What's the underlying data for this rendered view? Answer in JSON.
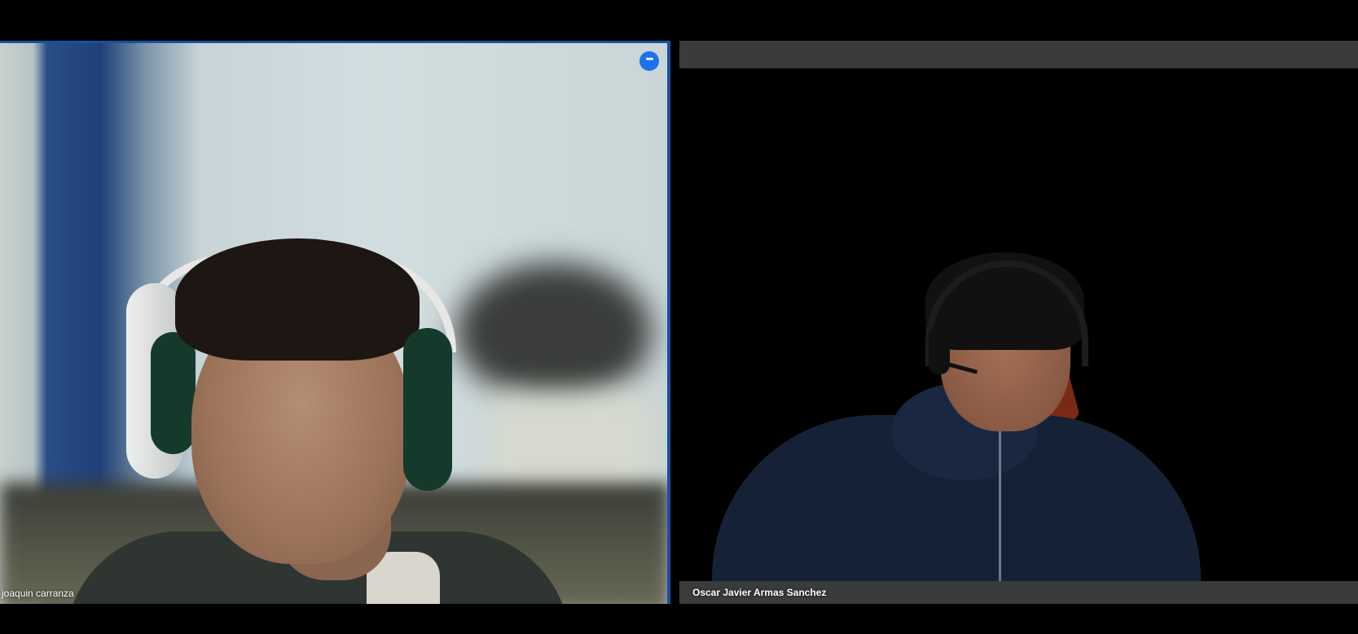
{
  "meeting": {
    "participants": [
      {
        "name": "joaquin carranza",
        "active_speaker": true
      },
      {
        "name": "Oscar Javier Armas Sanchez",
        "active_speaker": false
      }
    ]
  },
  "controls": {
    "more_options_glyph": "•••",
    "more_options_icon": "more-horizontal-icon"
  },
  "colors": {
    "active_border": "#1a4fa3",
    "more_button": "#1a73e8",
    "tile_bar": "#3a3c3c"
  }
}
